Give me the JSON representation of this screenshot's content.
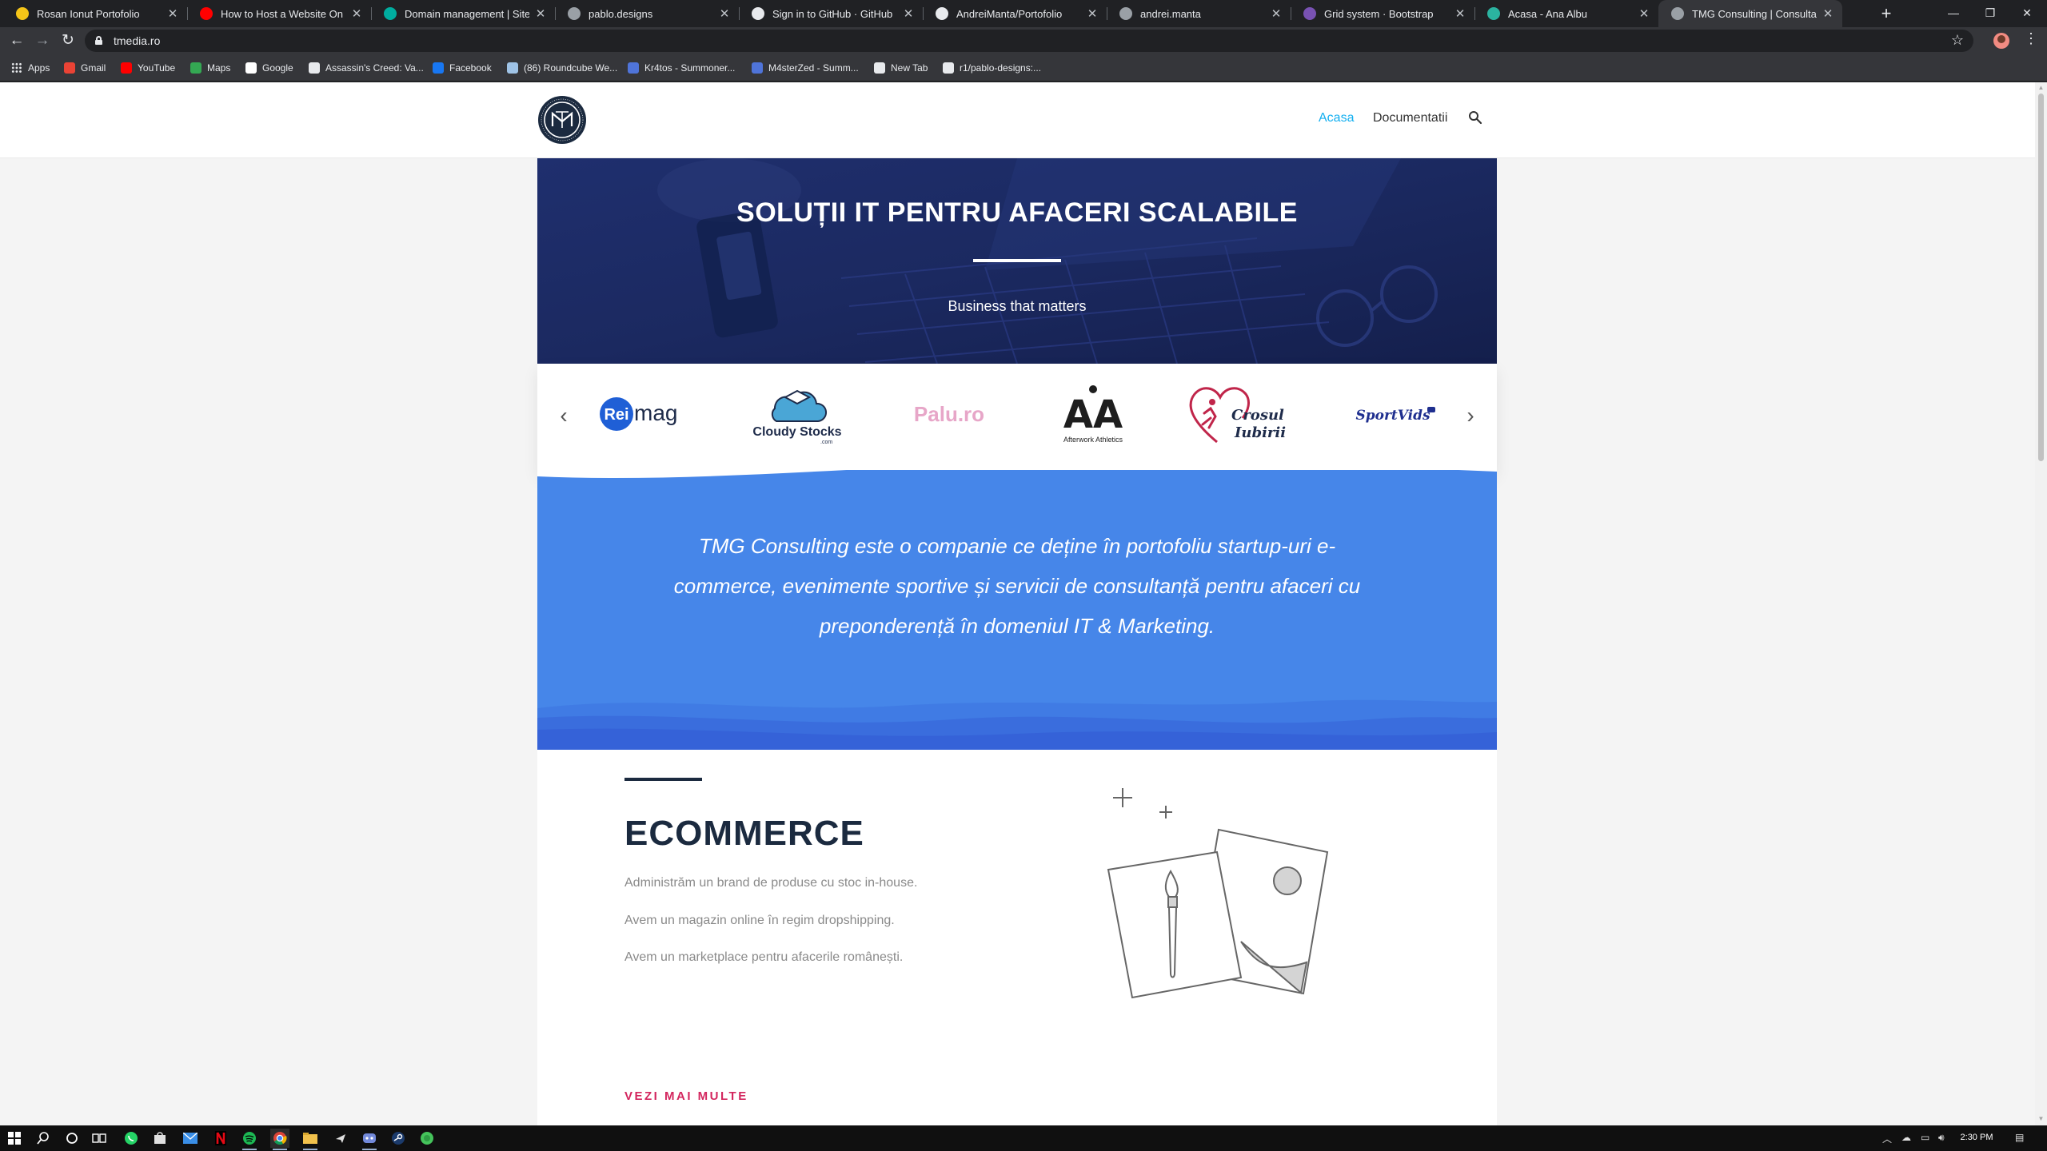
{
  "browser": {
    "tabs": [
      {
        "title": "Rosan Ionut Portofolio",
        "icon": "bolt-icon",
        "color": "#f5c518"
      },
      {
        "title": "How to Host a Website On Github",
        "icon": "youtube-icon",
        "color": "#ff0000"
      },
      {
        "title": "Domain management | Site settings",
        "icon": "diamond-icon",
        "color": "#00ad9f"
      },
      {
        "title": "pablo.designs",
        "icon": "globe-icon",
        "color": "#9aa0a6"
      },
      {
        "title": "Sign in to GitHub · GitHub",
        "icon": "github-icon",
        "color": "#e8eaed"
      },
      {
        "title": "AndreiManta/Portofolio",
        "icon": "github-icon",
        "color": "#e8eaed"
      },
      {
        "title": "andrei.manta",
        "icon": "globe-icon",
        "color": "#9aa0a6"
      },
      {
        "title": "Grid system · Bootstrap",
        "icon": "bootstrap-icon",
        "color": "#7952b3"
      },
      {
        "title": "Acasa - Ana Albu",
        "icon": "link-icon",
        "color": "#2bb3a0"
      },
      {
        "title": "TMG Consulting | Consultanță IT",
        "icon": "globe-icon",
        "color": "#9aa0a6",
        "active": true
      }
    ],
    "close_glyph": "✕",
    "new_tab_glyph": "+",
    "window_controls": [
      "—",
      "❐",
      "✕"
    ],
    "nav": {
      "back": "←",
      "forward": "→",
      "reload": "↻"
    },
    "url": "tmedia.ro",
    "star_glyph": "☆",
    "menu_glyph": "⋮",
    "bookmarks": [
      {
        "label": "Apps",
        "icon": "apps-icon",
        "color": "#e8eaed"
      },
      {
        "label": "Gmail",
        "icon": "gmail-icon",
        "color": "#ea4335"
      },
      {
        "label": "YouTube",
        "icon": "youtube-icon",
        "color": "#ff0000"
      },
      {
        "label": "Maps",
        "icon": "maps-icon",
        "color": "#34a853"
      },
      {
        "label": "Google",
        "icon": "google-icon",
        "color": "#ffffff"
      },
      {
        "label": "Assassin's Creed: Va...",
        "icon": "globe-icon",
        "color": "#e8eaed"
      },
      {
        "label": "Facebook",
        "icon": "facebook-icon",
        "color": "#1877f2"
      },
      {
        "label": "(86) Roundcube We...",
        "icon": "roundcube-icon",
        "color": "#9fc3e6"
      },
      {
        "label": "Kr4tos - Summoner...",
        "icon": "league-icon",
        "color": "#4f74d9"
      },
      {
        "label": "M4sterZed - Summ...",
        "icon": "league-icon",
        "color": "#4f74d9"
      },
      {
        "label": "New Tab",
        "icon": "globe-icon",
        "color": "#e8eaed"
      },
      {
        "label": "r1/pablo-designs:...",
        "icon": "github-icon",
        "color": "#e8eaed"
      }
    ]
  },
  "site": {
    "nav": [
      {
        "label": "Acasa",
        "active": true
      },
      {
        "label": "Documentatii",
        "active": false
      }
    ],
    "accent": "#13aff0",
    "hero": {
      "title": "SOLUȚII IT PENTRU AFACERI SCALABILE",
      "subtitle": "Business that matters"
    },
    "clients": {
      "prev_glyph": "‹",
      "next_glyph": "›",
      "logos": [
        {
          "name": "Reimag",
          "part1": "Rei",
          "part2": "mag"
        },
        {
          "name": "Cloudy Stocks",
          "text": "Cloudy Stocks",
          "sub": ".com"
        },
        {
          "name": "Palu.ro",
          "text": "Palu.ro"
        },
        {
          "name": "Afterwork Athletics",
          "mark": "AA",
          "text": "Afterwork Athletics"
        },
        {
          "name": "Crosul Iubirii",
          "line1": "Crosul",
          "line2": "Iubirii"
        },
        {
          "name": "SportVids",
          "text": "SportVids"
        }
      ]
    },
    "about": {
      "text": "TMG Consulting este o companie ce deține în portofoliu startup-uri e-commerce, evenimente sportive și servicii de consultanță pentru afaceri cu preponderență în domeniul IT & Marketing."
    },
    "ecommerce": {
      "heading": "ECOMMERCE",
      "lines": [
        "Administrăm un brand de produse cu stoc in-house.",
        "Avem un magazin online în regim dropshipping.",
        "Avem un marketplace pentru afacerile românești."
      ],
      "cta": "VEZI MAI MULTE"
    }
  },
  "taskbar": {
    "time": "2:30 PM",
    "pinned": [
      "windows-start-icon",
      "search-icon",
      "cortana-icon",
      "task-view-icon",
      "whatsapp-icon",
      "store-icon",
      "mail-icon",
      "netflix-icon",
      "spotify-icon",
      "chrome-icon",
      "file-explorer-icon",
      "plane-icon",
      "discord-icon",
      "steam-icon",
      "green-app-icon"
    ]
  }
}
